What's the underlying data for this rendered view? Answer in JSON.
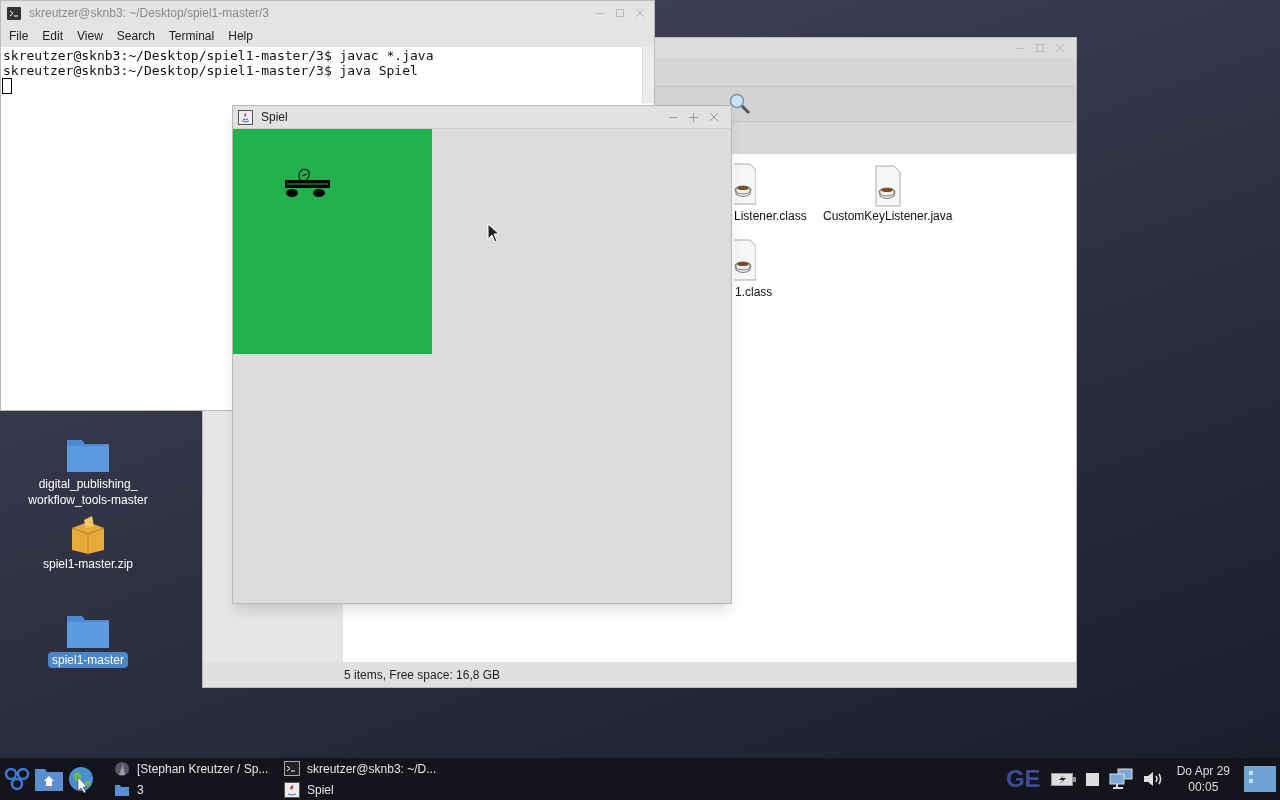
{
  "desktop_icons": [
    {
      "label": "digital_publishing_\nworkflow_tools-master",
      "kind": "folder",
      "selected": false
    },
    {
      "label": "spiel1-master.zip",
      "kind": "archive",
      "selected": false
    },
    {
      "label": "spiel1-master",
      "kind": "folder",
      "selected": true
    }
  ],
  "file_manager": {
    "files": [
      {
        "label": "Listener.class",
        "kind": "class"
      },
      {
        "label": "CustomKeyListener.java",
        "kind": "java"
      },
      {
        "label": "1.class",
        "kind": "class"
      }
    ],
    "status_bar": "5 items, Free space: 16,8 GB"
  },
  "terminal": {
    "title": "skreutzer@sknb3: ~/Desktop/spiel1-master/3",
    "active": false,
    "menu": [
      "File",
      "Edit",
      "View",
      "Search",
      "Terminal",
      "Help"
    ],
    "lines": [
      "skreutzer@sknb3:~/Desktop/spiel1-master/3$ javac *.java",
      "skreutzer@sknb3:~/Desktop/spiel1-master/3$ java Spiel"
    ]
  },
  "game_window": {
    "title": "Spiel",
    "active": true
  },
  "taskbar": {
    "tasks": [
      {
        "label": "[Stephan Kreutzer / Sp...",
        "kind": "browser"
      },
      {
        "label": "3",
        "kind": "folder"
      },
      {
        "label": "skreutzer@sknb3: ~/D...",
        "kind": "terminal"
      },
      {
        "label": "Spiel",
        "kind": "java"
      }
    ],
    "tray_text": "GE",
    "date": "Do Apr 29",
    "time": "00:05"
  }
}
